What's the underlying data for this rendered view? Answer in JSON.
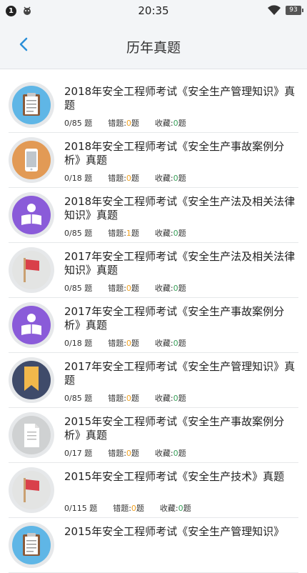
{
  "status_bar": {
    "notification_count": "1",
    "time": "20:35",
    "battery": "93"
  },
  "header": {
    "title": "历年真题"
  },
  "labels": {
    "wrong": "错题:",
    "fav": "收藏:",
    "unit": "题"
  },
  "items": [
    {
      "title": "2018年安全工程师考试《安全生产管理知识》真题",
      "progress": "0/85",
      "wrong": "0",
      "fav": "0",
      "icon": "clipboard-icon"
    },
    {
      "title": "2018年安全工程师考试《安全生产事故案例分析》真题",
      "progress": "0/18",
      "wrong": "0",
      "fav": "0",
      "icon": "phone-icon"
    },
    {
      "title": "2018年安全工程师考试《安全生产法及相关法律知识》真题",
      "progress": "0/85",
      "wrong": "1",
      "fav": "0",
      "icon": "reading-icon"
    },
    {
      "title": "2017年安全工程师考试《安全生产法及相关法律知识》真题",
      "progress": "0/85",
      "wrong": "0",
      "fav": "0",
      "icon": "flag-icon"
    },
    {
      "title": "2017年安全工程师考试《安全生产事故案例分析》真题",
      "progress": "0/18",
      "wrong": "0",
      "fav": "0",
      "icon": "reading-icon"
    },
    {
      "title": "2017年安全工程师考试《安全生产管理知识》真题",
      "progress": "0/85",
      "wrong": "0",
      "fav": "0",
      "icon": "bookmark-icon"
    },
    {
      "title": "2015年安全工程师考试《安全生产事故案例分析》真题",
      "progress": "0/17",
      "wrong": "0",
      "fav": "0",
      "icon": "document-icon"
    },
    {
      "title": "2015年安全工程师考试《安全生产技术》真题",
      "progress": "0/115",
      "wrong": "0",
      "fav": "0",
      "icon": "flag-icon"
    },
    {
      "title": "2015年安全工程师考试《安全生产管理知识》",
      "progress": "",
      "wrong": "",
      "fav": "",
      "icon": "clipboard-icon"
    }
  ]
}
